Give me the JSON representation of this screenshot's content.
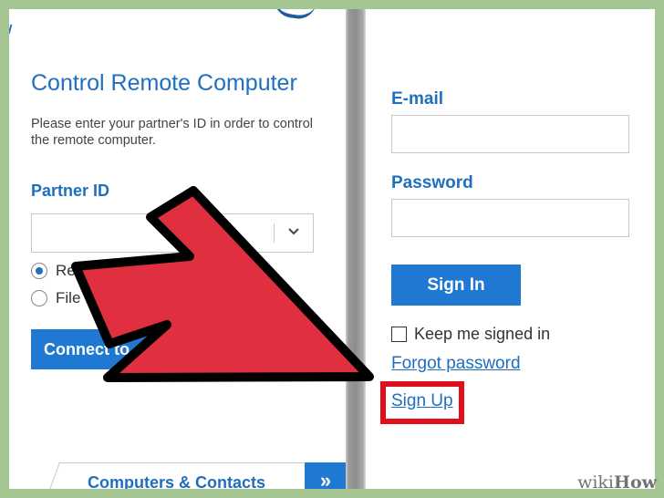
{
  "left_panel": {
    "title": "Control Remote Computer",
    "description": "Please enter your partner's ID in order to control the remote computer.",
    "partner_id_label": "Partner ID",
    "partner_id_value": "",
    "radio_remote_control": "Re",
    "radio_file_transfer": "File tra",
    "connect_button": "Connect to",
    "tab_label": "Computers & Contacts",
    "tab_next_glyph": "»"
  },
  "right_panel": {
    "email_label": "E-mail",
    "email_value": "",
    "password_label": "Password",
    "password_value": "",
    "sign_in_button": "Sign In",
    "keep_signed_in_label": "Keep me signed in",
    "forgot_password_link": "Forgot password",
    "sign_up_link": "Sign Up"
  },
  "overlay": {
    "arrow_color": "#e0303f",
    "highlight_color": "#e00f1b"
  },
  "watermark": {
    "part1": "wiki",
    "part2": "How"
  },
  "colors": {
    "background": "#a5c593",
    "accent_blue": "#1f6fbf",
    "button_blue": "#1f78d1"
  }
}
